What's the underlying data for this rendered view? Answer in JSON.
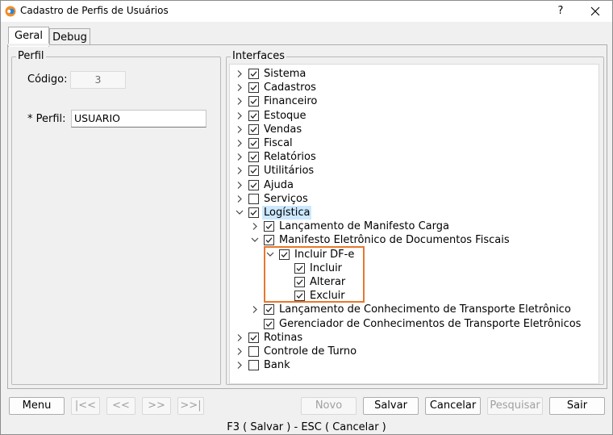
{
  "window": {
    "title": "Cadastro de Perfis de Usuários",
    "help": "?"
  },
  "tabs": [
    {
      "label": "Geral"
    },
    {
      "label": "Debug"
    }
  ],
  "perfil": {
    "group_title": "Perfil",
    "codigo_label": "Código:",
    "codigo_value": "3",
    "perfil_label": "* Perfil:",
    "perfil_value": "USUARIO"
  },
  "interfaces": {
    "group_title": "Interfaces",
    "tree": [
      {
        "label": "Sistema",
        "checked": true,
        "expander": "collapsed",
        "level": 0
      },
      {
        "label": "Cadastros",
        "checked": true,
        "expander": "collapsed",
        "level": 0
      },
      {
        "label": "Financeiro",
        "checked": true,
        "expander": "collapsed",
        "level": 0
      },
      {
        "label": "Estoque",
        "checked": true,
        "expander": "collapsed",
        "level": 0
      },
      {
        "label": "Vendas",
        "checked": true,
        "expander": "collapsed",
        "level": 0
      },
      {
        "label": "Fiscal",
        "checked": true,
        "expander": "collapsed",
        "level": 0
      },
      {
        "label": "Relatórios",
        "checked": true,
        "expander": "collapsed",
        "level": 0
      },
      {
        "label": "Utilitários",
        "checked": true,
        "expander": "collapsed",
        "level": 0
      },
      {
        "label": "Ajuda",
        "checked": true,
        "expander": "collapsed",
        "level": 0
      },
      {
        "label": "Serviços",
        "checked": false,
        "expander": "collapsed",
        "level": 0
      },
      {
        "label": "Logística",
        "checked": true,
        "expander": "expanded",
        "level": 0,
        "selected": true
      },
      {
        "label": "Lançamento de Manifesto Carga",
        "checked": true,
        "expander": "collapsed",
        "level": 1
      },
      {
        "label": "Manifesto Eletrônico de Documentos Fiscais",
        "checked": true,
        "expander": "expanded",
        "level": 1
      },
      {
        "label": "Incluir DF-e",
        "checked": true,
        "expander": "expanded",
        "level": 2
      },
      {
        "label": "Incluir",
        "checked": true,
        "expander": "none",
        "level": 3
      },
      {
        "label": "Alterar",
        "checked": true,
        "expander": "none",
        "level": 3
      },
      {
        "label": "Excluir",
        "checked": true,
        "expander": "none",
        "level": 3
      },
      {
        "label": "Lançamento de Conhecimento de Transporte Eletrônico",
        "checked": true,
        "expander": "collapsed",
        "level": 1
      },
      {
        "label": "Gerenciador de Conhecimentos de Transporte Eletrônicos",
        "checked": true,
        "expander": "none",
        "level": 1
      },
      {
        "label": "Rotinas",
        "checked": true,
        "expander": "collapsed",
        "level": 0
      },
      {
        "label": "Controle de Turno",
        "checked": false,
        "expander": "collapsed",
        "level": 0
      },
      {
        "label": "Bank",
        "checked": false,
        "expander": "collapsed",
        "level": 0
      }
    ]
  },
  "buttons": {
    "menu": "Menu",
    "first": "|<<",
    "prev": "<<",
    "next": ">>",
    "last": ">>|",
    "novo": "Novo",
    "salvar": "Salvar",
    "cancelar": "Cancelar",
    "pesquisar": "Pesquisar",
    "sair": "Sair"
  },
  "status": {
    "shortcuts": "F3 ( Salvar )  -  ESC ( Cancelar )"
  },
  "colors": {
    "highlight_border": "#e8772e",
    "selection": "#cce8ff"
  }
}
